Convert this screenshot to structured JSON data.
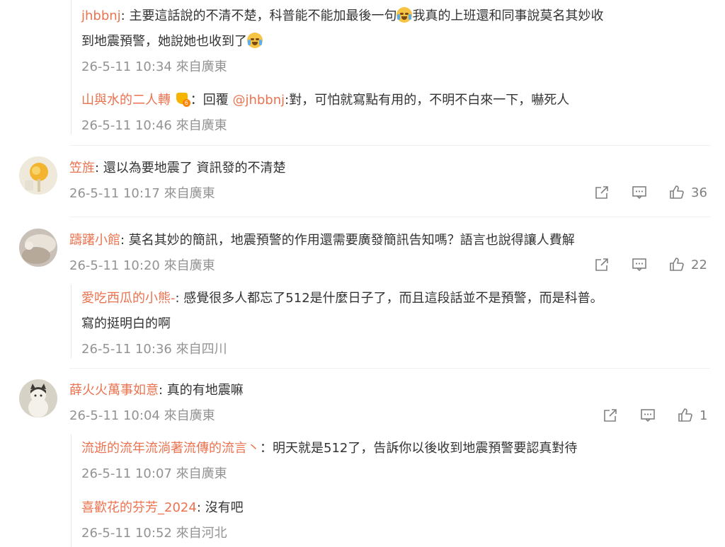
{
  "emoji": {
    "crying": "crying-face",
    "vip": "vip-badge"
  },
  "colors": {
    "username": "#eb7350",
    "meta": "#939393",
    "text": "#333333"
  },
  "top_replies": [
    {
      "user": "jhbbnj",
      "sep": ": ",
      "text_line1_a": "主要這話說的不清不楚，科普能不能加最後一句",
      "text_line1_b": "我真的上班還和同事說莫名其妙收",
      "text_line2": "到地震預警，她說她也收到了",
      "meta": "26-5-11 10:34 來自廣東"
    },
    {
      "user": "山與水的二人轉",
      "sep": "：回覆 ",
      "mention": "@jhbbnj",
      "text": ":對，可怕就寫點有用的，不明不白來一下，嚇死人",
      "meta": "26-5-11 10:46 來自廣東"
    }
  ],
  "comments": [
    {
      "user": "笠旌",
      "sep": ": ",
      "text": "還以為要地震了 資訊發的不清楚",
      "meta": "26-5-11 10:17 來自廣東",
      "likes": "36"
    },
    {
      "user": "躊躇小館",
      "sep": ": ",
      "text": "莫名其妙的簡訊，地震預警的作用還需要廣發簡訊告知嗎？語言也說得讓人費解",
      "meta": "26-5-11 10:20 來自廣東",
      "likes": "22",
      "reply": {
        "user": "愛吃西瓜的小熊-",
        "sep": ": ",
        "text_line1": "感覺很多人都忘了512是什麼日子了，而且這段話並不是預警，而是科普。",
        "text_line2": "寫的挺明白的啊",
        "meta": "26-5-11 10:36 來自四川"
      }
    },
    {
      "user": "薛火火萬事如意",
      "sep": ": ",
      "text": "真的有地震嘛",
      "meta": "26-5-11 10:04 來自廣東",
      "likes": "1",
      "replies": [
        {
          "user": "流逝的流年流淌著流傳的流言丶",
          "sep": "：",
          "text": "明天就是512了，告訴你以後收到地震預警要認真對待",
          "meta": "26-5-11 10:07 來自廣東"
        },
        {
          "user": "喜歡花的芬芳_2024",
          "sep": ": ",
          "text": "沒有吧",
          "meta": "26-5-11 10:52 來自河北"
        }
      ]
    }
  ]
}
